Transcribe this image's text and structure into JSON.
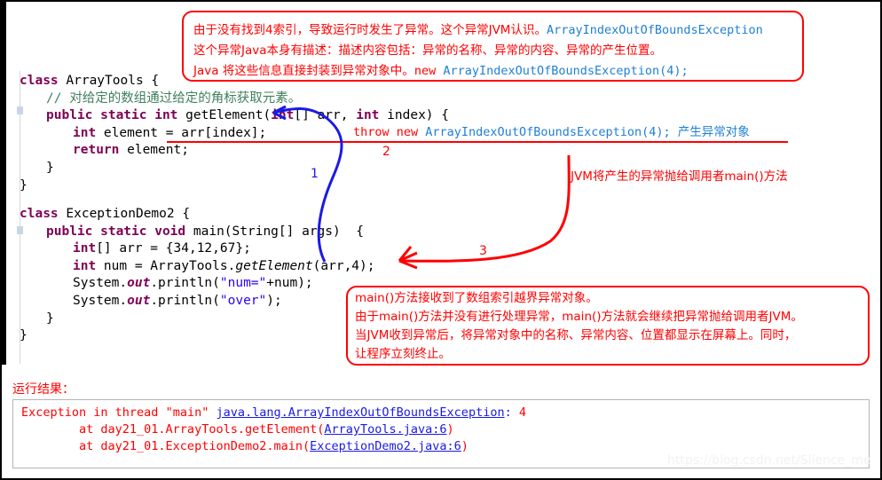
{
  "window": {
    "frame_color": "#000000",
    "background": "#ffffff"
  },
  "code_block_1": {
    "lines": [
      {
        "indent": 0,
        "segments": [
          {
            "t": "class ",
            "c": "kw"
          },
          {
            "t": "ArrayTools ",
            "c": "plain"
          },
          {
            "t": "{",
            "c": "brace"
          }
        ]
      },
      {
        "indent": 1,
        "segments": [
          {
            "t": "// 对给定的数组通过给定的角标获取元素。",
            "c": "cmt"
          }
        ]
      },
      {
        "indent": 1,
        "segments": [
          {
            "t": "public static int ",
            "c": "kw"
          },
          {
            "t": "getElement(",
            "c": "plain"
          },
          {
            "t": "int",
            "c": "kw"
          },
          {
            "t": "[] arr, ",
            "c": "plain"
          },
          {
            "t": "int",
            "c": "kw"
          },
          {
            "t": " index) {",
            "c": "plain"
          }
        ]
      },
      {
        "indent": 2,
        "segments": [
          {
            "t": "int",
            "c": "kw"
          },
          {
            "t": " element = arr[index];",
            "c": "plain"
          }
        ]
      },
      {
        "indent": 2,
        "segments": [
          {
            "t": "return",
            "c": "kw"
          },
          {
            "t": " element;",
            "c": "plain"
          }
        ]
      },
      {
        "indent": 1,
        "segments": [
          {
            "t": "}",
            "c": "brace"
          }
        ]
      },
      {
        "indent": 0,
        "segments": [
          {
            "t": "}",
            "c": "brace"
          }
        ]
      }
    ]
  },
  "code_block_2": {
    "lines": [
      {
        "indent": 0,
        "segments": [
          {
            "t": "class ",
            "c": "kw"
          },
          {
            "t": "ExceptionDemo2 ",
            "c": "plain"
          },
          {
            "t": "{",
            "c": "brace"
          }
        ]
      },
      {
        "indent": 1,
        "segments": [
          {
            "t": "public static void ",
            "c": "kw"
          },
          {
            "t": "main(String[] args)  {",
            "c": "plain"
          }
        ]
      },
      {
        "indent": 2,
        "segments": [
          {
            "t": "int",
            "c": "kw"
          },
          {
            "t": "[] arr = {34,12,67};",
            "c": "plain"
          }
        ]
      },
      {
        "indent": 2,
        "segments": [
          {
            "t": "int",
            "c": "kw"
          },
          {
            "t": " num = ArrayTools.",
            "c": "plain"
          },
          {
            "t": "getElement",
            "c": "itl"
          },
          {
            "t": "(arr,4);",
            "c": "plain"
          }
        ]
      },
      {
        "indent": 2,
        "segments": [
          {
            "t": "System.",
            "c": "plain"
          },
          {
            "t": "out",
            "c": "kwi"
          },
          {
            "t": ".println(",
            "c": "plain"
          },
          {
            "t": "\"num=\"",
            "c": "str"
          },
          {
            "t": "+num);",
            "c": "plain"
          }
        ]
      },
      {
        "indent": 2,
        "segments": [
          {
            "t": "System.",
            "c": "plain"
          },
          {
            "t": "out",
            "c": "kwi"
          },
          {
            "t": ".println(",
            "c": "plain"
          },
          {
            "t": "\"over\"",
            "c": "str"
          },
          {
            "t": ");",
            "c": "plain"
          }
        ]
      },
      {
        "indent": 1,
        "segments": [
          {
            "t": "}",
            "c": "brace"
          }
        ]
      },
      {
        "indent": 0,
        "segments": [
          {
            "t": "}",
            "c": "brace"
          }
        ]
      }
    ]
  },
  "annotation_top": {
    "line1_red": "由于没有找到4索引，导致运行时发生了异常。这个异常JVM认识。",
    "line1_blue": "ArrayIndexOutOfBoundsException",
    "line2_red": "这个异常Java本身有描述：描述内容包括：异常的名称、异常的内容、异常的产生位置。",
    "line3_red": "Java 将这些信息直接封装到异常对象中。",
    "line3_new": "new ",
    "line3_blue": "ArrayIndexOutOfBoundsException(4);"
  },
  "annotation_throw": {
    "red_part": "throw new ",
    "blue_part": "ArrayIndexOutOfBoundsException(4);",
    "tail_blue": " 产生异常对象"
  },
  "annotation_jvm": {
    "text": "JVM将产生的异常抛给调用者main()方法"
  },
  "annotation_bottom": {
    "line1": "main()方法接收到了数组索引越界异常对象。",
    "line2": "由于main()方法并没有进行处理异常，main()方法就会继续把异常抛给调用者JVM。",
    "line3": "当JVM收到异常后，将异常对象中的名称、异常内容、位置都显示在屏幕上。同时，",
    "line4": "让程序立刻终止。"
  },
  "markers": {
    "one": "1",
    "two": "2",
    "three": "3"
  },
  "result": {
    "label": "运行结果：",
    "console_lines": [
      {
        "segments": [
          {
            "t": "Exception in thread ",
            "c": "red"
          },
          {
            "t": "\"main\" ",
            "c": "red"
          },
          {
            "t": "java.lang.ArrayIndexOutOfBoundsException",
            "c": "link"
          },
          {
            "t": ": ",
            "c": "blue"
          },
          {
            "t": "4",
            "c": "red"
          }
        ]
      },
      {
        "segments": [
          {
            "t": "        at day21_01.ArrayTools.getElement(",
            "c": "red"
          },
          {
            "t": "ArrayTools.java:6",
            "c": "link"
          },
          {
            "t": ")",
            "c": "red"
          }
        ]
      },
      {
        "segments": [
          {
            "t": "        at day21_01.ExceptionDemo2.main(",
            "c": "red"
          },
          {
            "t": "ExceptionDemo2.java:6",
            "c": "link"
          },
          {
            "t": ")",
            "c": "red"
          }
        ]
      }
    ]
  },
  "watermark": {
    "text": "https://blog.csdn.net/Slience_me"
  },
  "colors": {
    "annotation_red": "#ff0000",
    "code_keyword": "#7f0055",
    "code_comment": "#3f7f5f",
    "code_string": "#2a00ff",
    "link_blue": "#1a1ae6",
    "annot_blue": "#1f7fd4"
  }
}
